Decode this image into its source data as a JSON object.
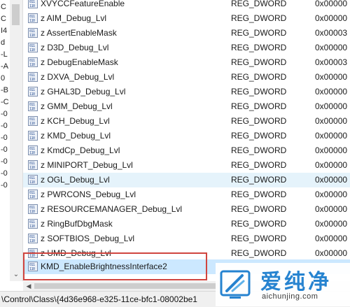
{
  "tree": {
    "fragments": [
      "C",
      "C",
      "I4",
      "d",
      "-L",
      "-A",
      "0",
      "-B",
      "-C",
      "-0",
      "-0",
      "-0",
      "-0",
      "-0",
      "-0",
      "-0"
    ]
  },
  "list": {
    "rows": [
      {
        "name": "XVYCCFeatureEnable",
        "type": "REG_DWORD",
        "data": "0x00000"
      },
      {
        "name": "z AIM_Debug_Lvl",
        "type": "REG_DWORD",
        "data": "0x00000"
      },
      {
        "name": "z AssertEnableMask",
        "type": "REG_DWORD",
        "data": "0x00003"
      },
      {
        "name": "z D3D_Debug_Lvl",
        "type": "REG_DWORD",
        "data": "0x00000"
      },
      {
        "name": "z DebugEnableMask",
        "type": "REG_DWORD",
        "data": "0x00003"
      },
      {
        "name": "z DXVA_Debug_Lvl",
        "type": "REG_DWORD",
        "data": "0x00000"
      },
      {
        "name": "z GHAL3D_Debug_Lvl",
        "type": "REG_DWORD",
        "data": "0x00000"
      },
      {
        "name": "z GMM_Debug_Lvl",
        "type": "REG_DWORD",
        "data": "0x00000"
      },
      {
        "name": "z KCH_Debug_Lvl",
        "type": "REG_DWORD",
        "data": "0x00000"
      },
      {
        "name": "z KMD_Debug_Lvl",
        "type": "REG_DWORD",
        "data": "0x00000"
      },
      {
        "name": "z KmdCp_Debug_Lvl",
        "type": "REG_DWORD",
        "data": "0x00000"
      },
      {
        "name": "z MINIPORT_Debug_Lvl",
        "type": "REG_DWORD",
        "data": "0x00000"
      },
      {
        "name": "z OGL_Debug_Lvl",
        "type": "REG_DWORD",
        "data": "0x00000"
      },
      {
        "name": "z PWRCONS_Debug_Lvl",
        "type": "REG_DWORD",
        "data": "0x00000"
      },
      {
        "name": "z RESOURCEMANAGER_Debug_Lvl",
        "type": "REG_DWORD",
        "data": "0x00000"
      },
      {
        "name": "z RingBufDbgMask",
        "type": "REG_DWORD",
        "data": "0x00000"
      },
      {
        "name": "z SOFTBIOS_Debug_Lvl",
        "type": "REG_DWORD",
        "data": "0x00000"
      },
      {
        "name": "z UMD_Debug_Lvl",
        "type": "REG_DWORD",
        "data": "0x00000"
      },
      {
        "name": "KMD_EnableBrightnessInterface2",
        "type": "",
        "data": ""
      }
    ],
    "icon_glyph": "ab\n01"
  },
  "status": {
    "path": "\\Control\\Class\\{4d36e968-e325-11ce-bfc1-08002be1"
  },
  "watermark": {
    "brand": "爱纯净",
    "url": "aichunjing.com"
  },
  "colors": {
    "hover_row": "#e5f3fb",
    "selected_row": "#cce8ff",
    "highlight_box": "#d0453f",
    "brand_blue": "#1f7fcf"
  }
}
